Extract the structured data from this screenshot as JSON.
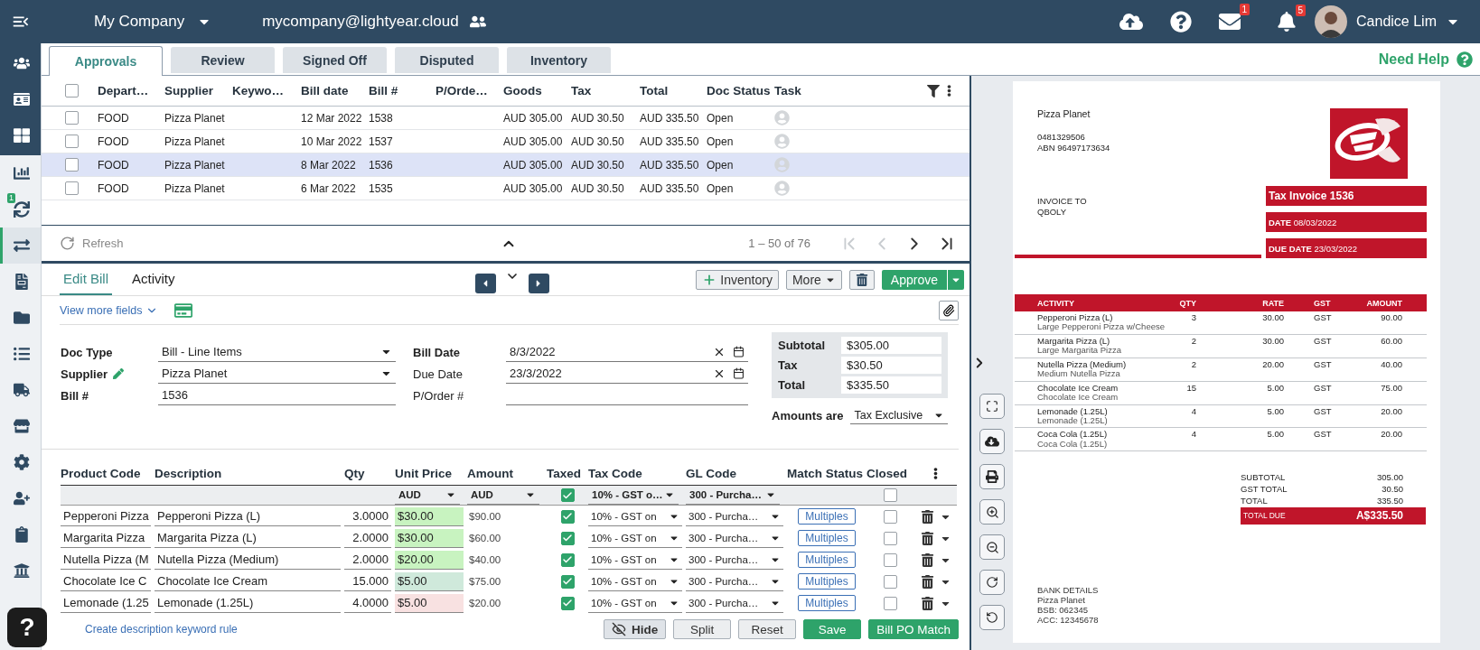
{
  "top_bar": {
    "company": "My Company",
    "email": "mycompany@lightyear.cloud",
    "mail_badge": "1",
    "notification_badge": "5",
    "user_name": "Candice Lim"
  },
  "sidebar": {
    "top_items": [
      {
        "selected": false
      },
      {
        "selected": false
      },
      {
        "selected": false
      }
    ],
    "items": [
      {
        "selected": false
      },
      {
        "selected": false,
        "badge": "1"
      },
      {
        "selected": true
      },
      {
        "selected": false
      },
      {
        "selected": false
      },
      {
        "selected": false
      },
      {
        "selected": false
      },
      {
        "selected": false
      },
      {
        "selected": false
      },
      {
        "selected": false
      },
      {
        "selected": false
      },
      {
        "selected": false
      }
    ]
  },
  "help_button": "?",
  "tabs": [
    {
      "label": "Approvals",
      "selected": true
    },
    {
      "label": "Review",
      "selected": false
    },
    {
      "label": "Signed Off",
      "selected": false
    },
    {
      "label": "Disputed",
      "selected": false
    },
    {
      "label": "Inventory",
      "selected": false
    }
  ],
  "need_help": "Need Help",
  "bills_table": {
    "select_all": false,
    "columns": [
      "Depart…",
      "Supplier",
      "Keywo…",
      "Bill date",
      "Bill #",
      "P/Orde…",
      "Goods",
      "Tax",
      "Total",
      "Doc Status",
      "Task"
    ],
    "rows": [
      {
        "department": "FOOD",
        "supplier": "Pizza Planet",
        "bill_date": "12 Mar 2022",
        "bill_no": "1538",
        "goods": "AUD 305.00",
        "tax": "AUD 30.50",
        "total": "AUD 335.50",
        "status": "Open",
        "checked": false,
        "selected": false
      },
      {
        "department": "FOOD",
        "supplier": "Pizza Planet",
        "bill_date": "10 Mar 2022",
        "bill_no": "1537",
        "goods": "AUD 305.00",
        "tax": "AUD 30.50",
        "total": "AUD 335.50",
        "status": "Open",
        "checked": false,
        "selected": false
      },
      {
        "department": "FOOD",
        "supplier": "Pizza Planet",
        "bill_date": "8 Mar 2022",
        "bill_no": "1536",
        "goods": "AUD 305.00",
        "tax": "AUD 30.50",
        "total": "AUD 335.50",
        "status": "Open",
        "checked": false,
        "selected": true
      },
      {
        "department": "FOOD",
        "supplier": "Pizza Planet",
        "bill_date": "6 Mar 2022",
        "bill_no": "1535",
        "goods": "AUD 305.00",
        "tax": "AUD 30.50",
        "total": "AUD 335.50",
        "status": "Open",
        "checked": false,
        "selected": false
      }
    ]
  },
  "pager": {
    "refresh": "Refresh",
    "range": "1 – 50 of 76",
    "nav": [
      {
        "kind": "first",
        "disabled": true
      },
      {
        "kind": "previous",
        "disabled": true
      },
      {
        "kind": "next",
        "disabled": false
      },
      {
        "kind": "last",
        "disabled": false
      }
    ]
  },
  "editor": {
    "tabs": [
      {
        "label": "Edit Bill",
        "selected": true
      },
      {
        "label": "Activity",
        "selected": false
      }
    ],
    "inventory": "Inventory",
    "more": "More",
    "approve": "Approve",
    "view_more": "View more fields"
  },
  "bill_form": {
    "fields": [
      {
        "label": "Doc Type",
        "value": "Bill - Line Items",
        "kind": "dropdown",
        "required": true,
        "editable": false
      },
      {
        "label": "Supplier",
        "value": "Pizza Planet",
        "kind": "dropdown",
        "required": true,
        "editable": true
      },
      {
        "label": "Bill #",
        "value": "1536",
        "kind": "text",
        "required": true,
        "editable": false
      },
      {
        "label": "Bill Date",
        "value": "8/3/2022",
        "kind": "date",
        "required": true,
        "editable": false
      },
      {
        "label": "Due Date",
        "value": "23/3/2022",
        "kind": "date",
        "required": false,
        "editable": false
      },
      {
        "label": "P/Order #",
        "kind": "text",
        "required": false,
        "editable": false
      }
    ],
    "totals": [
      {
        "label": "Subtotal",
        "value": "$305.00"
      },
      {
        "label": "Tax",
        "value": "$30.50"
      },
      {
        "label": "Total",
        "value": "$335.50"
      }
    ],
    "amounts_label": "Amounts are",
    "amounts_value": "Tax Exclusive"
  },
  "line_items": {
    "columns": [
      "Product Code",
      "Description",
      "Qty",
      "Unit Price",
      "Amount",
      "Taxed",
      "Tax Code",
      "GL Code",
      "Match Status",
      "Closed"
    ],
    "defaults": {
      "unit_price_currency": "AUD",
      "amount_currency": "AUD",
      "taxed": true,
      "tax_code": "10% - GST o…",
      "gl_code": "300 - Purcha…",
      "closed": false
    },
    "rows": [
      {
        "product_code": "Pepperoni Pizza",
        "description": "Pepperoni Pizza (L)",
        "qty": "3.0000",
        "unit_price": "$30.00",
        "color": "#c8f3c0",
        "amount": "$90.00",
        "taxed": true,
        "tax_code": "10% - GST on",
        "gl_code": "300 - Purcha…",
        "match_status": "Multiples",
        "closed": false
      },
      {
        "product_code": "Margarita Pizza",
        "description": "Margarita Pizza (L)",
        "qty": "2.0000",
        "unit_price": "$30.00",
        "color": "#c8f3c0",
        "amount": "$60.00",
        "taxed": true,
        "tax_code": "10% - GST on",
        "gl_code": "300 - Purcha…",
        "match_status": "Multiples",
        "closed": false
      },
      {
        "product_code": "Nutella Pizza (M",
        "description": "Nutella Pizza (Medium)",
        "qty": "2.0000",
        "unit_price": "$20.00",
        "color": "#c8f3c0",
        "amount": "$40.00",
        "taxed": true,
        "tax_code": "10% - GST on",
        "gl_code": "300 - Purcha…",
        "match_status": "Multiples",
        "closed": false
      },
      {
        "product_code": "Chocolate Ice C",
        "description": "Chocolate Ice Cream",
        "qty": "15.000",
        "unit_price": "$5.00",
        "color": "#cfe9db",
        "amount": "$75.00",
        "taxed": true,
        "tax_code": "10% - GST on",
        "gl_code": "300 - Purcha…",
        "match_status": "Multiples",
        "closed": false
      },
      {
        "product_code": "Lemonade (1.25",
        "description": "Lemonade (1.25L)",
        "qty": "4.0000",
        "unit_price": "$5.00",
        "color": "#f8e1e1",
        "amount": "$20.00",
        "taxed": true,
        "tax_code": "10% - GST on",
        "gl_code": "300 - Purcha…",
        "match_status": "Multiples",
        "closed": false
      }
    ]
  },
  "footer": {
    "link": "Create description keyword rule",
    "buttons": [
      {
        "label": "Hide",
        "kind": "toggle"
      },
      {
        "label": "Split",
        "kind": "secondary"
      },
      {
        "label": "Reset",
        "kind": "secondary"
      },
      {
        "label": "Save",
        "kind": "primary"
      },
      {
        "label": "Bill PO Match",
        "kind": "primary"
      }
    ]
  },
  "invoice": {
    "supplier": "Pizza Planet",
    "phone": "0481329506",
    "abn": "ABN 96497173634",
    "invoice_to_label": "INVOICE TO",
    "invoice_to": "QBOLY",
    "title": "Tax Invoice 1536",
    "date": "**DATE** 08/03/2022",
    "due_date": "**DUE DATE** 23/03/2022",
    "columns": [
      "ACTIVITY",
      "QTY",
      "RATE",
      "GST",
      "AMOUNT"
    ],
    "lines": [
      {
        "name": "Pepperoni Pizza (L)",
        "description": "Large Pepperoni Pizza w/Cheese",
        "qty": "3",
        "rate": "30.00",
        "gst": "GST",
        "amount": "90.00"
      },
      {
        "name": "Margarita Pizza (L)",
        "description": "Large Margarita Pizza",
        "qty": "2",
        "rate": "30.00",
        "gst": "GST",
        "amount": "60.00"
      },
      {
        "name": "Nutella Pizza (Medium)",
        "description": "Medium Nutella Pizza",
        "qty": "2",
        "rate": "20.00",
        "gst": "GST",
        "amount": "40.00"
      },
      {
        "name": "Chocolate Ice Cream",
        "description": "Chocolate Ice Cream",
        "qty": "15",
        "rate": "5.00",
        "gst": "GST",
        "amount": "75.00"
      },
      {
        "name": "Lemonade (1.25L)",
        "description": "Lemonade (1.25L)",
        "qty": "4",
        "rate": "5.00",
        "gst": "GST",
        "amount": "20.00"
      },
      {
        "name": "Coca Cola (1.25L)",
        "description": "Coca Cola (1.25L)",
        "qty": "4",
        "rate": "5.00",
        "gst": "GST",
        "amount": "20.00"
      }
    ],
    "totals": [
      {
        "label": "SUBTOTAL",
        "value": "305.00"
      },
      {
        "label": "GST TOTAL",
        "value": "30.50"
      },
      {
        "label": "TOTAL",
        "value": "335.50"
      }
    ],
    "total_due": {
      "label": "TOTAL DUE",
      "value": "A$335.50"
    },
    "bank_details": [
      "BANK DETAILS",
      "Pizza Planet",
      "BSB: 062345",
      "ACC: 12345678"
    ]
  }
}
